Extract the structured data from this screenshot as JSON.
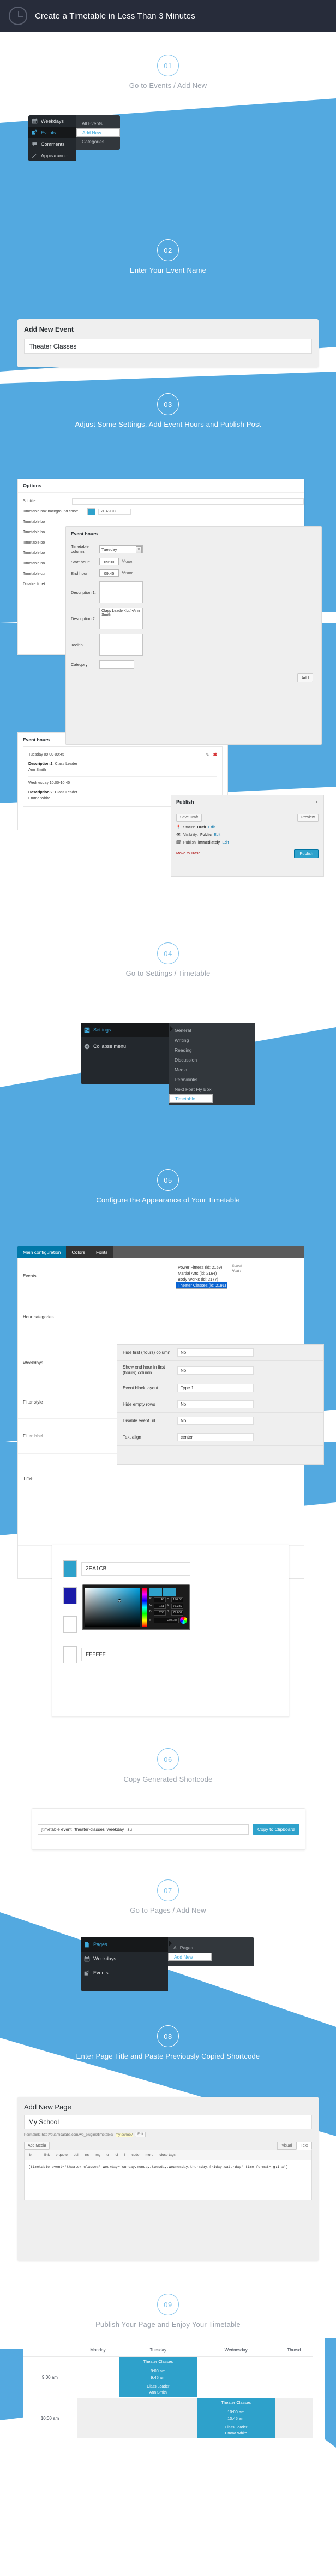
{
  "header": {
    "title": "Create a Timetable in Less Than 3 Minutes",
    "icon": "clock-icon"
  },
  "accent": {
    "blue": "#53a9e0",
    "wp_blue": "#2ea2cc",
    "dark": "#23282d"
  },
  "steps": [
    {
      "num": "01",
      "caption": "Go to Events / Add New"
    },
    {
      "num": "02",
      "caption": "Enter Your Event Name"
    },
    {
      "num": "03",
      "caption": "Adjust Some Settings, Add Event Hours and Publish Post"
    },
    {
      "num": "04",
      "caption": "Go to Settings / Timetable"
    },
    {
      "num": "05",
      "caption": "Configure the Appearance of Your Timetable"
    },
    {
      "num": "06",
      "caption": "Copy Generated Shortcode"
    },
    {
      "num": "07",
      "caption": "Go to Pages / Add New"
    },
    {
      "num": "08",
      "caption": "Enter Page Title and Paste Previously Copied Shortcode"
    },
    {
      "num": "09",
      "caption": "Publish Your Page and Enjoy Your Timetable"
    }
  ],
  "menu_events": {
    "items": [
      {
        "label": "Weekdays",
        "icon": "calendar-icon",
        "active": false
      },
      {
        "label": "Events",
        "icon": "pencil-post-icon",
        "active": true
      },
      {
        "label": "Comments",
        "icon": "comment-icon",
        "active": false
      },
      {
        "label": "Appearance",
        "icon": "brush-icon",
        "active": false
      }
    ],
    "sub": [
      {
        "label": "All Events",
        "selected": false
      },
      {
        "label": "Add New",
        "selected": true
      },
      {
        "label": "Categories",
        "selected": false
      }
    ]
  },
  "menu_settings": {
    "items": [
      {
        "label": "Settings",
        "icon": "sliders-icon",
        "active": true
      },
      {
        "label": "Collapse menu",
        "icon": "collapse-arrow-icon",
        "active": false
      }
    ],
    "sub": [
      {
        "label": "General",
        "selected": false
      },
      {
        "label": "Writing",
        "selected": false
      },
      {
        "label": "Reading",
        "selected": false
      },
      {
        "label": "Discussion",
        "selected": false
      },
      {
        "label": "Media",
        "selected": false
      },
      {
        "label": "Permalinks",
        "selected": false
      },
      {
        "label": "Next Post Fly Box",
        "selected": false
      },
      {
        "label": "Timetable",
        "selected": true
      }
    ]
  },
  "menu_pages": {
    "items": [
      {
        "label": "Pages",
        "icon": "pages-icon",
        "active": true
      },
      {
        "label": "Weekdays",
        "icon": "calendar-icon",
        "active": false
      },
      {
        "label": "Events",
        "icon": "pencil-post-icon",
        "active": false
      }
    ],
    "sub": [
      {
        "label": "All Pages",
        "selected": false
      },
      {
        "label": "Add New",
        "selected": true
      }
    ]
  },
  "add_event": {
    "heading": "Add New Event",
    "title_value": "Theater Classes"
  },
  "options": {
    "heading": "Options",
    "rows": [
      {
        "label": "Subtitle:",
        "value": ""
      },
      {
        "label": "Timetable box background color:",
        "value": "2EA2CC",
        "swatch": "#2ea2cc"
      },
      {
        "label": "Timetable bo",
        "value": ""
      },
      {
        "label": "Timetable bo",
        "value": ""
      },
      {
        "label": "Timetable bo",
        "value": ""
      },
      {
        "label": "Timetable bo",
        "value": ""
      },
      {
        "label": "Timetable bo",
        "value": ""
      },
      {
        "label": "Timetable cu",
        "value": ""
      },
      {
        "label": "Disable timet",
        "value": ""
      }
    ]
  },
  "event_hours_form": {
    "heading": "Event hours",
    "column_label": "Timetable column:",
    "column_value": "Tuesday",
    "start_label": "Start hour:",
    "start_value": "09:00",
    "end_label": "End hour:",
    "end_value": "09:45",
    "hint": "hh:mm",
    "desc1_label": "Description 1:",
    "desc1_value": "",
    "desc2_label": "Description 2:",
    "desc2_value": "Class Leader<br/>Ann Smith",
    "tooltip_label": "Tooltip:",
    "tooltip_value": "",
    "category_label": "Category:",
    "category_value": "",
    "add_button": "Add"
  },
  "event_hours_list": {
    "heading": "Event hours",
    "entries": [
      {
        "when": "Tuesday 09:00-09:45",
        "desc_label": "Description 2:",
        "desc_value": "Class Leader",
        "desc_line2": "Ann Smith"
      },
      {
        "when": "Wednesday 10:00-10:45",
        "desc_label": "Description 2:",
        "desc_value": "Class Leader",
        "desc_line2": "Emma White"
      }
    ],
    "edit_icon": "pencil-icon",
    "delete_icon": "close-x-icon"
  },
  "publish": {
    "heading": "Publish",
    "collapse_icon": "chevron-up-icon",
    "save_draft": "Save Draft",
    "preview": "Preview",
    "status_label": "Status:",
    "status_value": "Draft",
    "status_edit": "Edit",
    "visibility_label": "Visibility:",
    "visibility_value": "Public",
    "visibility_edit": "Edit",
    "schedule_label": "Publish",
    "schedule_value": "immediately",
    "schedule_edit": "Edit",
    "trash": "Move to Trash",
    "publish_button": "Publish"
  },
  "appearance": {
    "tabs": [
      {
        "label": "Main configuration",
        "active": true
      },
      {
        "label": "Colors",
        "active": false
      },
      {
        "label": "Fonts",
        "active": false
      }
    ],
    "rows": [
      {
        "label": "Events"
      },
      {
        "label": "Hour categories"
      },
      {
        "label": "Weekdays"
      },
      {
        "label": "Filter style"
      },
      {
        "label": "Filter label"
      },
      {
        "label": "Time"
      }
    ],
    "events_list": [
      {
        "label": "Power Fitness (id: 2159)",
        "selected": false
      },
      {
        "label": "Martial Arts (id: 2164)",
        "selected": false
      },
      {
        "label": "Body Works (id: 2177)",
        "selected": false
      },
      {
        "label": "Theater Classes (id: 2191)",
        "selected": true
      }
    ],
    "hint_line1": "Select",
    "hint_line2": "Hold t",
    "overlay_rows": [
      {
        "label": "Hide first (hours) column",
        "value": "No"
      },
      {
        "label": "Show end hour in first (hours) column",
        "value": "No"
      },
      {
        "label": "Event block layout",
        "value": "Type 1"
      },
      {
        "label": "Hide empty rows",
        "value": "No"
      },
      {
        "label": "Disable event url",
        "value": "No"
      },
      {
        "label": "Text align",
        "value": "center"
      }
    ],
    "color_hex_main": "2EA1CB",
    "color_hex_white": "FFFFFF",
    "swatch_main": "#2ea1cb",
    "swatch_blue": "#1b1ba8",
    "picker": {
      "r_label": "R",
      "r_value": "46",
      "g_label": "G",
      "g_value": "161",
      "b_label": "B",
      "b_value": "203",
      "h_label": "H",
      "h_value": "196.05",
      "s_label": "S",
      "s_value": "77.339",
      "br_label": "B",
      "br_value": "79.607",
      "hash_label": "#",
      "hash_value": "2ea1cb",
      "wheel_icon": "color-wheel-icon"
    }
  },
  "shortcode": {
    "value": "[timetable event='theater-classes' weekday='su",
    "button": "Copy to Clipboard"
  },
  "add_page": {
    "heading": "Add New Page",
    "title_value": "My School",
    "permalink_prefix": "Permalink: http://quanticalabs.com/wp_plugins/timetable/",
    "permalink_slug": "my-school/",
    "permalink_edit": "Edit",
    "add_media": "Add Media",
    "tab_visual": "Visual",
    "tab_text": "Text",
    "toolbar": [
      "b",
      "i",
      "link",
      "b-quote",
      "del",
      "ins",
      "img",
      "ul",
      "ol",
      "li",
      "code",
      "more",
      "close tags"
    ],
    "content": "[timetable event='theater-classes' weekday='sunday,monday,tuesday,wednesday,thursday,friday,saturday' time_format='g:i a']"
  },
  "timetable": {
    "columns": [
      "",
      "Monday",
      "Tuesday",
      "Wednesday",
      "Thursd"
    ],
    "rows": [
      {
        "hour": "9:00 am",
        "cells": [
          {
            "type": "empty"
          },
          {
            "type": "event",
            "name": "Theater Classes",
            "start": "9:00 am",
            "end": "9:45 am",
            "leader_role": "Class Leader",
            "leader_name": "Ann Smith"
          },
          {
            "type": "empty"
          },
          {
            "type": "empty"
          }
        ]
      },
      {
        "hour": "10:00 am",
        "cells": [
          {
            "type": "empty"
          },
          {
            "type": "empty"
          },
          {
            "type": "event",
            "name": "Theater Classes",
            "start": "10:00 am",
            "end": "10:45 am",
            "leader_role": "Class Leader",
            "leader_name": "Emma White"
          },
          {
            "type": "empty"
          }
        ]
      }
    ]
  }
}
